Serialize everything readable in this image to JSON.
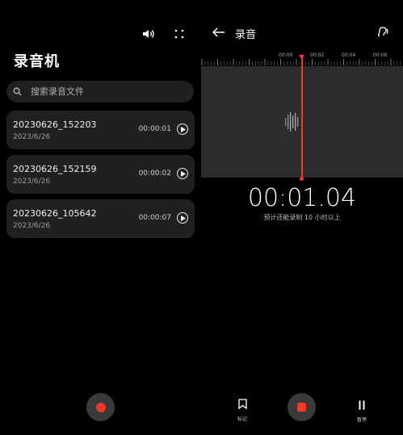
{
  "left": {
    "title": "录音机",
    "search": {
      "placeholder": "搜索录音文件"
    },
    "recordings": [
      {
        "name": "20230626_152203",
        "date": "2023/6/26",
        "duration": "00:00:01"
      },
      {
        "name": "20230626_152159",
        "date": "2023/6/26",
        "duration": "00:00:02"
      },
      {
        "name": "20230626_105642",
        "date": "2023/6/26",
        "duration": "00:00:07"
      }
    ],
    "top_icons": [
      "speaker-icon",
      "more-options-icon"
    ],
    "record_button_icon": "record-dot-icon"
  },
  "right": {
    "title": "录音",
    "ruler_labels": [
      "00:00",
      "00:02",
      "00:04",
      "00:06"
    ],
    "timer": "00:01.04",
    "remaining": "预计还能录制 10 小时以上",
    "mark_label": "标记",
    "pause_label": "暂停",
    "icons": [
      "back-arrow-icon",
      "ear-icon",
      "bookmark-icon",
      "stop-icon",
      "pause-icon"
    ]
  },
  "colors": {
    "accent": "#f0382b",
    "card": "#202022",
    "wave_bg": "#2c2c2e",
    "button_bg": "#3a3a3c"
  }
}
